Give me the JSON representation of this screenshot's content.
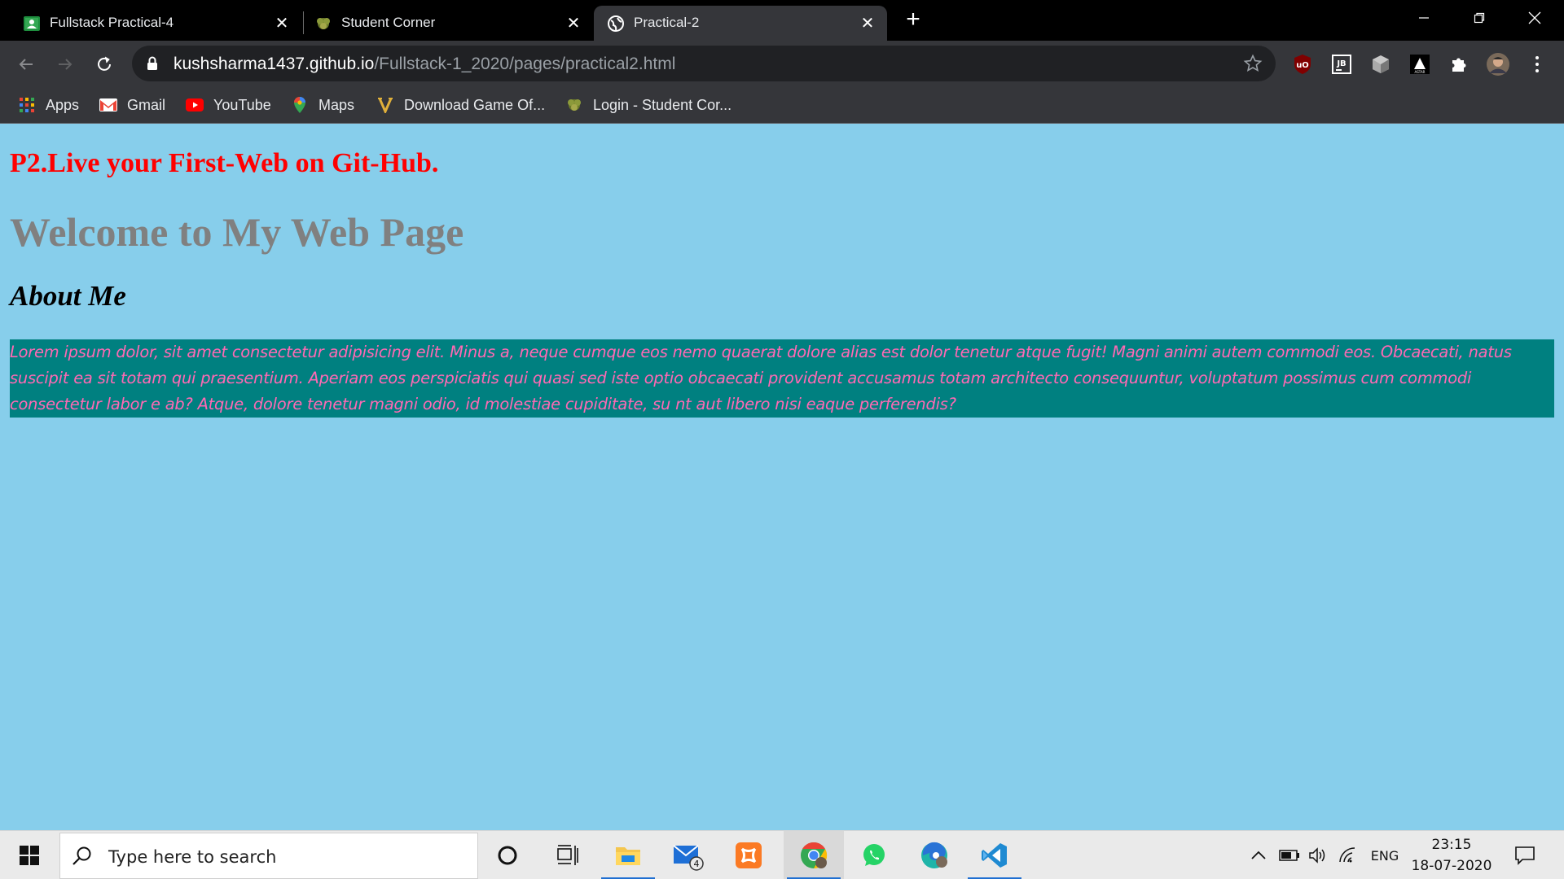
{
  "browser": {
    "tabs": [
      {
        "title": "Fullstack Practical-4",
        "icon": "google-classroom-icon",
        "active": false
      },
      {
        "title": "Student Corner",
        "icon": "student-corner-icon",
        "active": false
      },
      {
        "title": "Practical-2",
        "icon": "globe-icon",
        "active": true
      }
    ],
    "address": {
      "host": "kushsharma1437.github.io",
      "path": "/Fullstack-1_2020/pages/practical2.html"
    },
    "extensions": [
      "ublock-icon",
      "jetbrains-icon",
      "box-extension-icon",
      "astar-extension-icon",
      "puzzle-icon",
      "profile-avatar"
    ],
    "bookmarks": [
      {
        "label": "Apps",
        "icon": "apps-grid-icon"
      },
      {
        "label": "Gmail",
        "icon": "gmail-icon"
      },
      {
        "label": "YouTube",
        "icon": "youtube-icon"
      },
      {
        "label": "Maps",
        "icon": "maps-pin-icon"
      },
      {
        "label": "Download Game Of...",
        "icon": "v-logo-icon"
      },
      {
        "label": "Login - Student Cor...",
        "icon": "student-corner-icon"
      }
    ]
  },
  "page": {
    "practical_heading": "P2.Live your First-Web on Git-Hub.",
    "welcome_heading": "Welcome to My Web Page",
    "about_heading": "About Me",
    "about_text": "Lorem ipsum dolor, sit amet consectetur adipisicing elit. Minus a, neque cumque eos nemo quaerat dolore alias est dolor tenetur atque fugit! Magni animi autem commodi eos. Obcaecati, natus suscipit ea sit totam qui praesentium. Aperiam eos perspiciatis qui quasi sed iste optio obcaecati provident accusamus totam architecto consequuntur, voluptatum possimus cum commodi consectetur labor e ab? Atque, dolore tenetur magni odio, id molestiae cupiditate, su nt aut libero nisi eaque perferendis?",
    "colors": {
      "background": "#87ceeb",
      "heading_red": "#ff0000",
      "welcome_gray": "#808080",
      "lorem_bg": "#008080",
      "lorem_text": "#ff69b4"
    }
  },
  "taskbar": {
    "search_placeholder": "Type here to search",
    "pinned": [
      "cortana-circle-icon",
      "task-view-icon",
      "file-explorer-icon",
      "mail-icon",
      "xampp-icon",
      "chrome-icon",
      "whatsapp-icon",
      "edge-icon",
      "vscode-icon"
    ],
    "mail_badge": "4",
    "tray": {
      "language": "ENG",
      "time": "23:15",
      "date": "18-07-2020"
    }
  }
}
